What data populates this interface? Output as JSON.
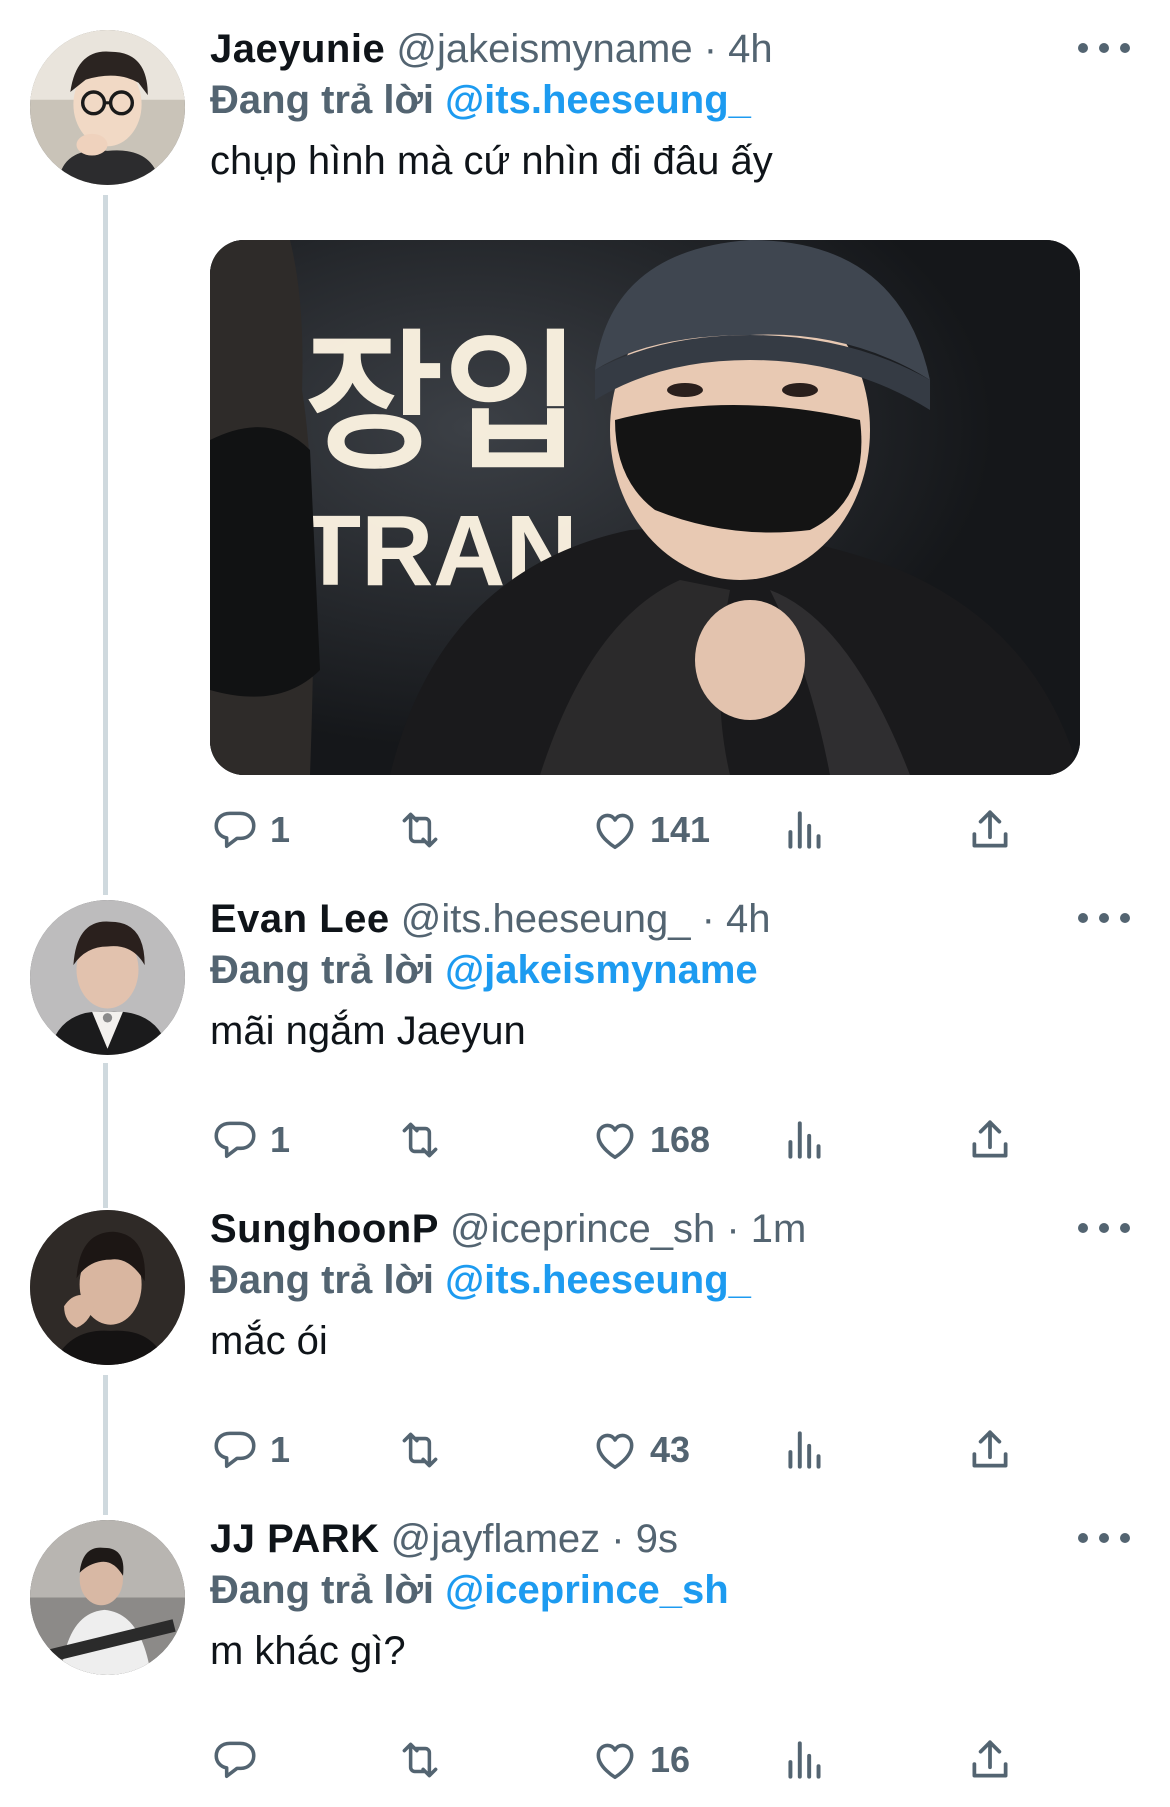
{
  "thread": {
    "reply_prefix": "Đang trả lời",
    "tweets": [
      {
        "name": "Jaeyunie",
        "handle": "@jakeismyname",
        "separator": "·",
        "time": "4h",
        "reply_to": "@its.heeseung_",
        "text": "chụp hình mà cứ nhìn đi đâu ấy",
        "media_text": [
          "장입",
          "TRAN"
        ],
        "replies": "1",
        "retweets": "",
        "likes": "141"
      },
      {
        "name": "Evan Lee",
        "handle": "@its.heeseung_",
        "separator": "·",
        "time": "4h",
        "reply_to": "@jakeismyname",
        "text": "mãi ngắm Jaeyun",
        "replies": "1",
        "retweets": "",
        "likes": "168"
      },
      {
        "name": "SunghoonP",
        "handle": "@iceprince_sh",
        "separator": "·",
        "time": "1m",
        "reply_to": "@its.heeseung_",
        "text": "mắc ói",
        "replies": "1",
        "retweets": "",
        "likes": "43"
      },
      {
        "name": "JJ PARK",
        "handle": "@jayflamez",
        "separator": "·",
        "time": "9s",
        "reply_to": "@iceprince_sh",
        "text": "m khác gì?",
        "replies": "",
        "retweets": "",
        "likes": "16"
      }
    ]
  },
  "colors": {
    "text": "#0f1419",
    "secondary": "#536471",
    "link": "#1d9bf0",
    "thread_line": "#cfd9de"
  },
  "icons": [
    "reply-icon",
    "retweet-icon",
    "like-icon",
    "views-icon",
    "share-icon",
    "more-icon"
  ]
}
